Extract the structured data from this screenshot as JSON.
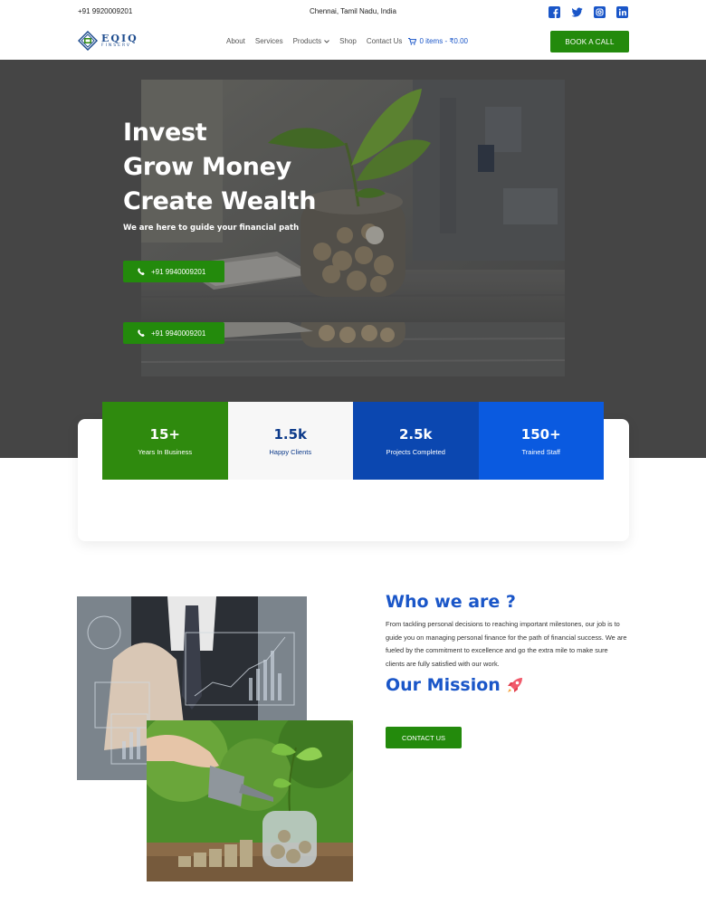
{
  "topbar": {
    "phone": "+91 9920009201",
    "location": "Chennai, Tamil Nadu, India",
    "socials": [
      "facebook-icon",
      "twitter-icon",
      "instagram-icon",
      "linkedin-icon"
    ]
  },
  "header": {
    "logo_main": "EQIQ",
    "logo_sub": "FINSERV",
    "nav": [
      "About",
      "Services",
      "Products",
      "Shop",
      "Contact Us"
    ],
    "cart": "0 items - ₹0.00",
    "cta": "BOOK A CALL"
  },
  "hero": {
    "title_lines": [
      "Invest",
      "Grow Money",
      "Create Wealth"
    ],
    "subtitle": "We are here to guide your financial path",
    "call_button": "+91 9940009201",
    "call_button_2": "+91 9940009201"
  },
  "stats": [
    {
      "value": "15+",
      "label": "Years In Business",
      "bg": "#2f8a0e",
      "fg": "#ffffff"
    },
    {
      "value": "1.5k",
      "label": "Happy Clients",
      "bg": "#f7f7f7",
      "fg": "#0c3a8a"
    },
    {
      "value": "2.5k",
      "label": "Projects Completed",
      "bg": "#0b47b0",
      "fg": "#ffffff"
    },
    {
      "value": "150+",
      "label": "Trained Staff",
      "bg": "#0a5ae0",
      "fg": "#ffffff"
    }
  ],
  "about": {
    "who_title": "Who we are ?",
    "who_text": "From tackling personal decisions to reaching important milestones, our job is to guide you on managing personal finance for the path of financial success. We are fueled by the commitment to excellence and go the extra mile to make sure clients are fully satisfied with our work.",
    "mission_title": "Our Mission",
    "contact_button": "CONTACT US"
  },
  "colors": {
    "brand_green": "#238a0c",
    "brand_blue": "#1a56c8",
    "hero_bg": "#454545"
  }
}
